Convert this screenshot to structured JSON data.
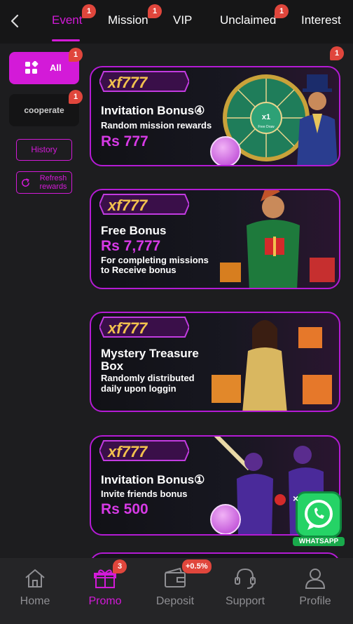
{
  "topnav": {
    "tabs": [
      {
        "label": "Event",
        "badge": "1",
        "active": true
      },
      {
        "label": "Mission",
        "badge": "1"
      },
      {
        "label": "VIP"
      },
      {
        "label": "Unclaimed",
        "badge": "1"
      },
      {
        "label": "Interest"
      }
    ]
  },
  "sidebar": {
    "all_label": "All",
    "all_badge": "1",
    "cooperate_label": "cooperate",
    "cooperate_badge": "1",
    "history_label": "History",
    "refresh_label": "Refresh rewards"
  },
  "banners": [
    {
      "badge": "1",
      "logo_text": "xf777",
      "title": "Invitation Bonus④",
      "subtitle": "Random mission rewards",
      "amount": "Rs 777",
      "wheel_center": "x1",
      "wheel_sub": "Free Draw"
    },
    {
      "logo_text": "xf777",
      "title": "Free Bonus",
      "amount": "Rs 7,777",
      "subtitle_1": "For completing missions",
      "subtitle_2": "to Receive bonus"
    },
    {
      "logo_text": "xf777",
      "title_1": "Mystery Treasure",
      "title_2": "Box",
      "subtitle_1": "Randomly distributed",
      "subtitle_2": "daily upon loggin"
    },
    {
      "logo_text": "xf777",
      "title": "Invitation Bonus①",
      "subtitle": "Invite friends bonus",
      "amount": "Rs 500"
    }
  ],
  "whatsapp": {
    "label": "WHATSAPP",
    "close": "×"
  },
  "bottomnav": {
    "items": [
      {
        "label": "Home"
      },
      {
        "label": "Promo",
        "badge": "3",
        "active": true
      },
      {
        "label": "Deposit",
        "badge": "+0.5%"
      },
      {
        "label": "Support"
      },
      {
        "label": "Profile"
      }
    ]
  },
  "colors": {
    "accent": "#d31ad8",
    "badge": "#e0463c",
    "background": "#1d1d1f"
  }
}
